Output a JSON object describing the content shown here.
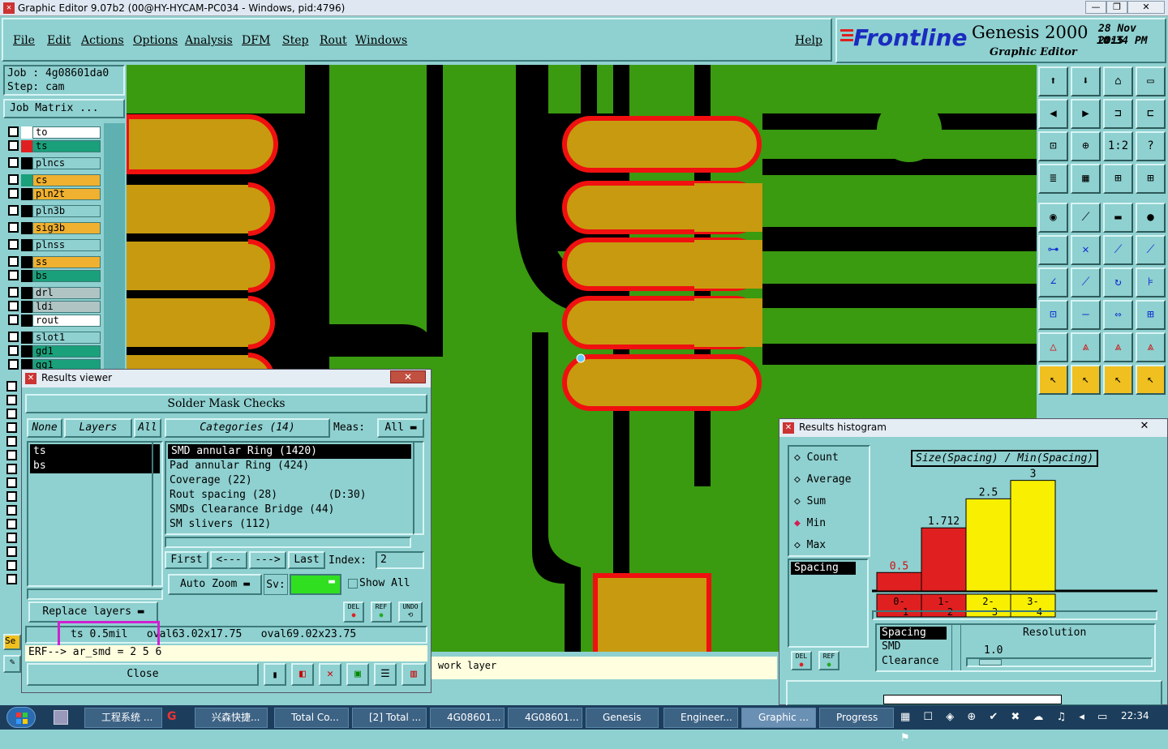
{
  "window": {
    "title": "Graphic Editor 9.07b2 (00@HY-HYCAM-PC034 - Windows, pid:4796)"
  },
  "menu": [
    "File",
    "Edit",
    "Actions",
    "Options",
    "Analysis",
    "DFM",
    "Step",
    "Rout",
    "Windows"
  ],
  "help": "Help",
  "brand": {
    "logo": "Frontline",
    "product": "Genesis 2000",
    "subtitle": "Graphic Editor",
    "date": "28 Nov 2015",
    "time": "10:34 PM"
  },
  "job": {
    "job": "Job : 4g08601da0",
    "step": "Step: cam",
    "matrix": "Job Matrix ..."
  },
  "layers": [
    {
      "name": "to",
      "color": "#ffffff",
      "box": "#ffffff"
    },
    {
      "name": "ts",
      "color": "#1aa07a",
      "box": "#e02020"
    },
    {
      "name": "plncs",
      "color": "#8fd0d0",
      "box": "#000000"
    },
    {
      "name": "cs",
      "color": "#f0b030",
      "box": "#1aa07a"
    },
    {
      "name": "pln2t",
      "color": "#f0b030",
      "box": "#000000"
    },
    {
      "name": "pln3b",
      "color": "#8fd0d0",
      "box": "#000000"
    },
    {
      "name": "sig3b",
      "color": "#f0b030",
      "box": "#000000"
    },
    {
      "name": "plnss",
      "color": "#8fd0d0",
      "box": "#000000"
    },
    {
      "name": "ss",
      "color": "#f0b030",
      "box": "#000000"
    },
    {
      "name": "bs",
      "color": "#1aa07a",
      "box": "#000000"
    },
    {
      "name": "drl",
      "color": "#b0c4c4",
      "box": "#000000"
    },
    {
      "name": "ldi",
      "color": "#b0c4c4",
      "box": "#000000"
    },
    {
      "name": "rout",
      "color": "#ffffff",
      "box": "#000000"
    },
    {
      "name": "slot1",
      "color": "#8fd0d0",
      "box": "#000000"
    },
    {
      "name": "gd1",
      "color": "#1aa07a",
      "box": "#000000"
    },
    {
      "name": "gg1",
      "color": "#1aa07a",
      "box": "#000000"
    }
  ],
  "results_viewer": {
    "title": "Results viewer",
    "heading": "Solder Mask Checks",
    "none": "None",
    "layers": "Layers",
    "all": "All",
    "categories": "Categories (14)",
    "meas_label": "Meas:",
    "meas_value": "All",
    "layer_items": [
      "ts",
      "bs"
    ],
    "category_items": [
      "SMD annular Ring (1420)",
      "Pad annular Ring (424)",
      "Coverage (22)",
      "Rout spacing (28)        (D:30)",
      "SMDs Clearance Bridge (44)",
      "SM slivers (112)"
    ],
    "first": "First",
    "prev": "<---",
    "next": "--->",
    "last": "Last",
    "index_label": "Index:",
    "index_value": "2",
    "auto_zoom": "Auto Zoom",
    "sv_label": "Sv:",
    "show_all": "Show All",
    "replace_layers": "Replace layers",
    "del": "DEL",
    "ref": "REF",
    "undo": "UNDO",
    "status": "ts 0.5mil   oval63.02x17.75   oval69.02x23.75",
    "erf": "ERF--> ar_smd = 2 5 6",
    "close": "Close"
  },
  "work_layer": "work layer",
  "histogram": {
    "title": "Results histogram",
    "options": [
      "Count",
      "Average",
      "Sum",
      "Min",
      "Max"
    ],
    "selected": "Min",
    "list_item": "Spacing",
    "chart_title": "Size(Spacing) / Min(Spacing)",
    "resolution_label": "Resolution",
    "resolution_value": "1.0",
    "bottom_items": [
      "Spacing",
      "SMD",
      "Clearance"
    ],
    "del": "DEL",
    "ref": "REF"
  },
  "chart_data": {
    "type": "bar",
    "title": "Size(Spacing) / Min(Spacing)",
    "categories": [
      "0-1",
      "1-2",
      "2-3",
      "3-4"
    ],
    "values": [
      0.5,
      1.712,
      2.5,
      3
    ],
    "labels": [
      "0.5",
      "1.712",
      "2.5",
      "3"
    ],
    "colors": [
      "#e02020",
      "#e02020",
      "#f8f000",
      "#f8f000"
    ],
    "ylim": [
      0,
      3.3
    ]
  },
  "taskbar": {
    "items": [
      "工程系统 ...",
      "兴森快捷...",
      "Total Co...",
      "[2] Total ...",
      "4G08601...",
      "4G08601...",
      "Genesis",
      "Engineer...",
      "Graphic ...",
      "Progress"
    ],
    "clock": "22:34"
  },
  "left_se": "Se"
}
